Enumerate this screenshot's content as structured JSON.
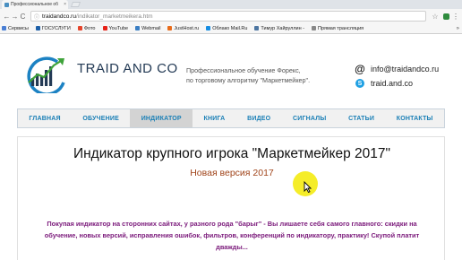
{
  "browser": {
    "tab": {
      "title": "Профессиональное об",
      "close": "×"
    },
    "nav": {
      "back": "←",
      "forward": "→",
      "reload": "C"
    },
    "url": {
      "host": "traidandco.ru",
      "path": "/indikator_marketmeikera.htm"
    },
    "menu": "⋮",
    "bookmarks": [
      {
        "label": "Сервисы",
        "color": "#4a7fd4"
      },
      {
        "label": "ГОСУСЛУГИ",
        "color": "#1d5fa8"
      },
      {
        "label": "Фото",
        "color": "#e5442b"
      },
      {
        "label": "YouTube",
        "color": "#e62117"
      },
      {
        "label": "Webmail",
        "color": "#3b7fc4"
      },
      {
        "label": "JustHost.ru",
        "color": "#e86b1a"
      },
      {
        "label": "Облако Mail.Ru",
        "color": "#168de2"
      },
      {
        "label": "Тимур Хайруллин - ",
        "color": "#4d76a1"
      },
      {
        "label": "Прямая трансляция",
        "color": "#888888"
      }
    ],
    "bookmarks_more": "»"
  },
  "header": {
    "brand": "TRAID AND CO",
    "tagline_line1": "Профессиональное обучение Форекс,",
    "tagline_line2": "по торговому алгоритму \"Маркетмейкер\".",
    "email": "info@traidandco.ru",
    "skype": "traid.and.co"
  },
  "nav": {
    "items": [
      {
        "label": "ГЛАВНАЯ",
        "active": false
      },
      {
        "label": "ОБУЧЕНИЕ",
        "active": false
      },
      {
        "label": "ИНДИКАТОР",
        "active": true
      },
      {
        "label": "КНИГА",
        "active": false
      },
      {
        "label": "ВИДЕО",
        "active": false
      },
      {
        "label": "СИГНАЛЫ",
        "active": false
      },
      {
        "label": "СТАТЬИ",
        "active": false
      },
      {
        "label": "КОНТАКТЫ",
        "active": false
      }
    ]
  },
  "content": {
    "headline": "Индикатор крупного игрока \"Маркетмейкер 2017\"",
    "subheadline": "Новая версия 2017",
    "promo": "Покупая индикатор на сторонних сайтах, у разного рода \"барыг\" - Вы лишаете себя самого главного:  скидки на обучение, новых версий, исправления ошибок, фильтров, конференций по индикатору, практику! Скупой платит дважды..."
  },
  "colors": {
    "brand": "#233a55",
    "nav_text": "#1a7fb6",
    "subheadline": "#a0441a",
    "promo": "#7b1a7b",
    "cursor_highlight": "#f4ec1e"
  }
}
